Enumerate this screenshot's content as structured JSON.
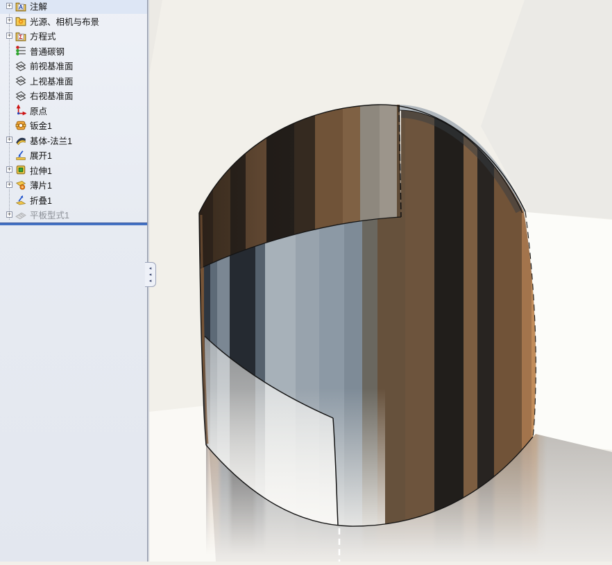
{
  "feature_tree": {
    "items": [
      {
        "label": "注解",
        "icon": "annotations-folder-icon",
        "expandable": true,
        "disabled": false
      },
      {
        "label": "光源、相机与布景",
        "icon": "lights-cameras-scene-folder-icon",
        "expandable": true,
        "disabled": false
      },
      {
        "label": "方程式",
        "icon": "equations-folder-icon",
        "expandable": true,
        "disabled": false
      },
      {
        "label": "普通碳钢",
        "icon": "material-icon",
        "expandable": false,
        "disabled": false
      },
      {
        "label": "前视基准面",
        "icon": "plane-icon",
        "expandable": false,
        "disabled": false
      },
      {
        "label": "上视基准面",
        "icon": "plane-icon",
        "expandable": false,
        "disabled": false
      },
      {
        "label": "右视基准面",
        "icon": "plane-icon",
        "expandable": false,
        "disabled": false
      },
      {
        "label": "原点",
        "icon": "origin-icon",
        "expandable": false,
        "disabled": false
      },
      {
        "label": "钣金1",
        "icon": "sheet-metal-icon",
        "expandable": false,
        "disabled": false
      },
      {
        "label": "基体-法兰1",
        "icon": "base-flange-icon",
        "expandable": true,
        "disabled": false
      },
      {
        "label": "展开1",
        "icon": "unfold-icon",
        "expandable": false,
        "disabled": false
      },
      {
        "label": "拉伸1",
        "icon": "extrude-icon",
        "expandable": true,
        "disabled": false
      },
      {
        "label": "薄片1",
        "icon": "tab-icon",
        "expandable": true,
        "disabled": false
      },
      {
        "label": "折叠1",
        "icon": "fold-icon",
        "expandable": false,
        "disabled": false
      },
      {
        "label": "平板型式1",
        "icon": "flat-pattern-icon",
        "expandable": true,
        "disabled": true
      }
    ],
    "rollback_bar_color": "#4472c4"
  },
  "viewport": {
    "scene": "sheet-metal rolled cylinder with step cut, shaded-with-edges view",
    "background_color": "#f2f0ea",
    "floor_color": "#c7c4c0",
    "metal_colors": {
      "steel_blue": "#a7b1b9",
      "dark_band": "#252a31",
      "brown": "#6d543d",
      "copper_edge": "#c18c5a"
    }
  }
}
